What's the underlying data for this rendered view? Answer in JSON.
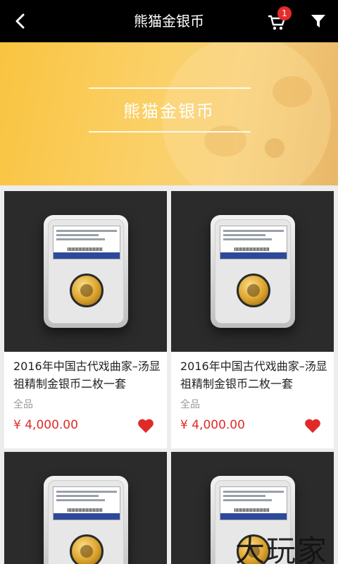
{
  "header": {
    "title": "熊猫金银币",
    "cart_badge": "1"
  },
  "banner": {
    "title": "熊猫金银币"
  },
  "products": [
    {
      "title": "2016年中国古代戏曲家–汤显祖精制金银币二枚一套",
      "grade": "全品",
      "price": "¥ 4,000.00"
    },
    {
      "title": "2016年中国古代戏曲家–汤显祖精制金银币二枚一套",
      "grade": "全品",
      "price": "¥ 4,000.00"
    }
  ],
  "watermark": "大玩家",
  "colors": {
    "accent_red": "#e02a2a",
    "header_bg": "#000000",
    "banner_yellow": "#f9c440"
  }
}
